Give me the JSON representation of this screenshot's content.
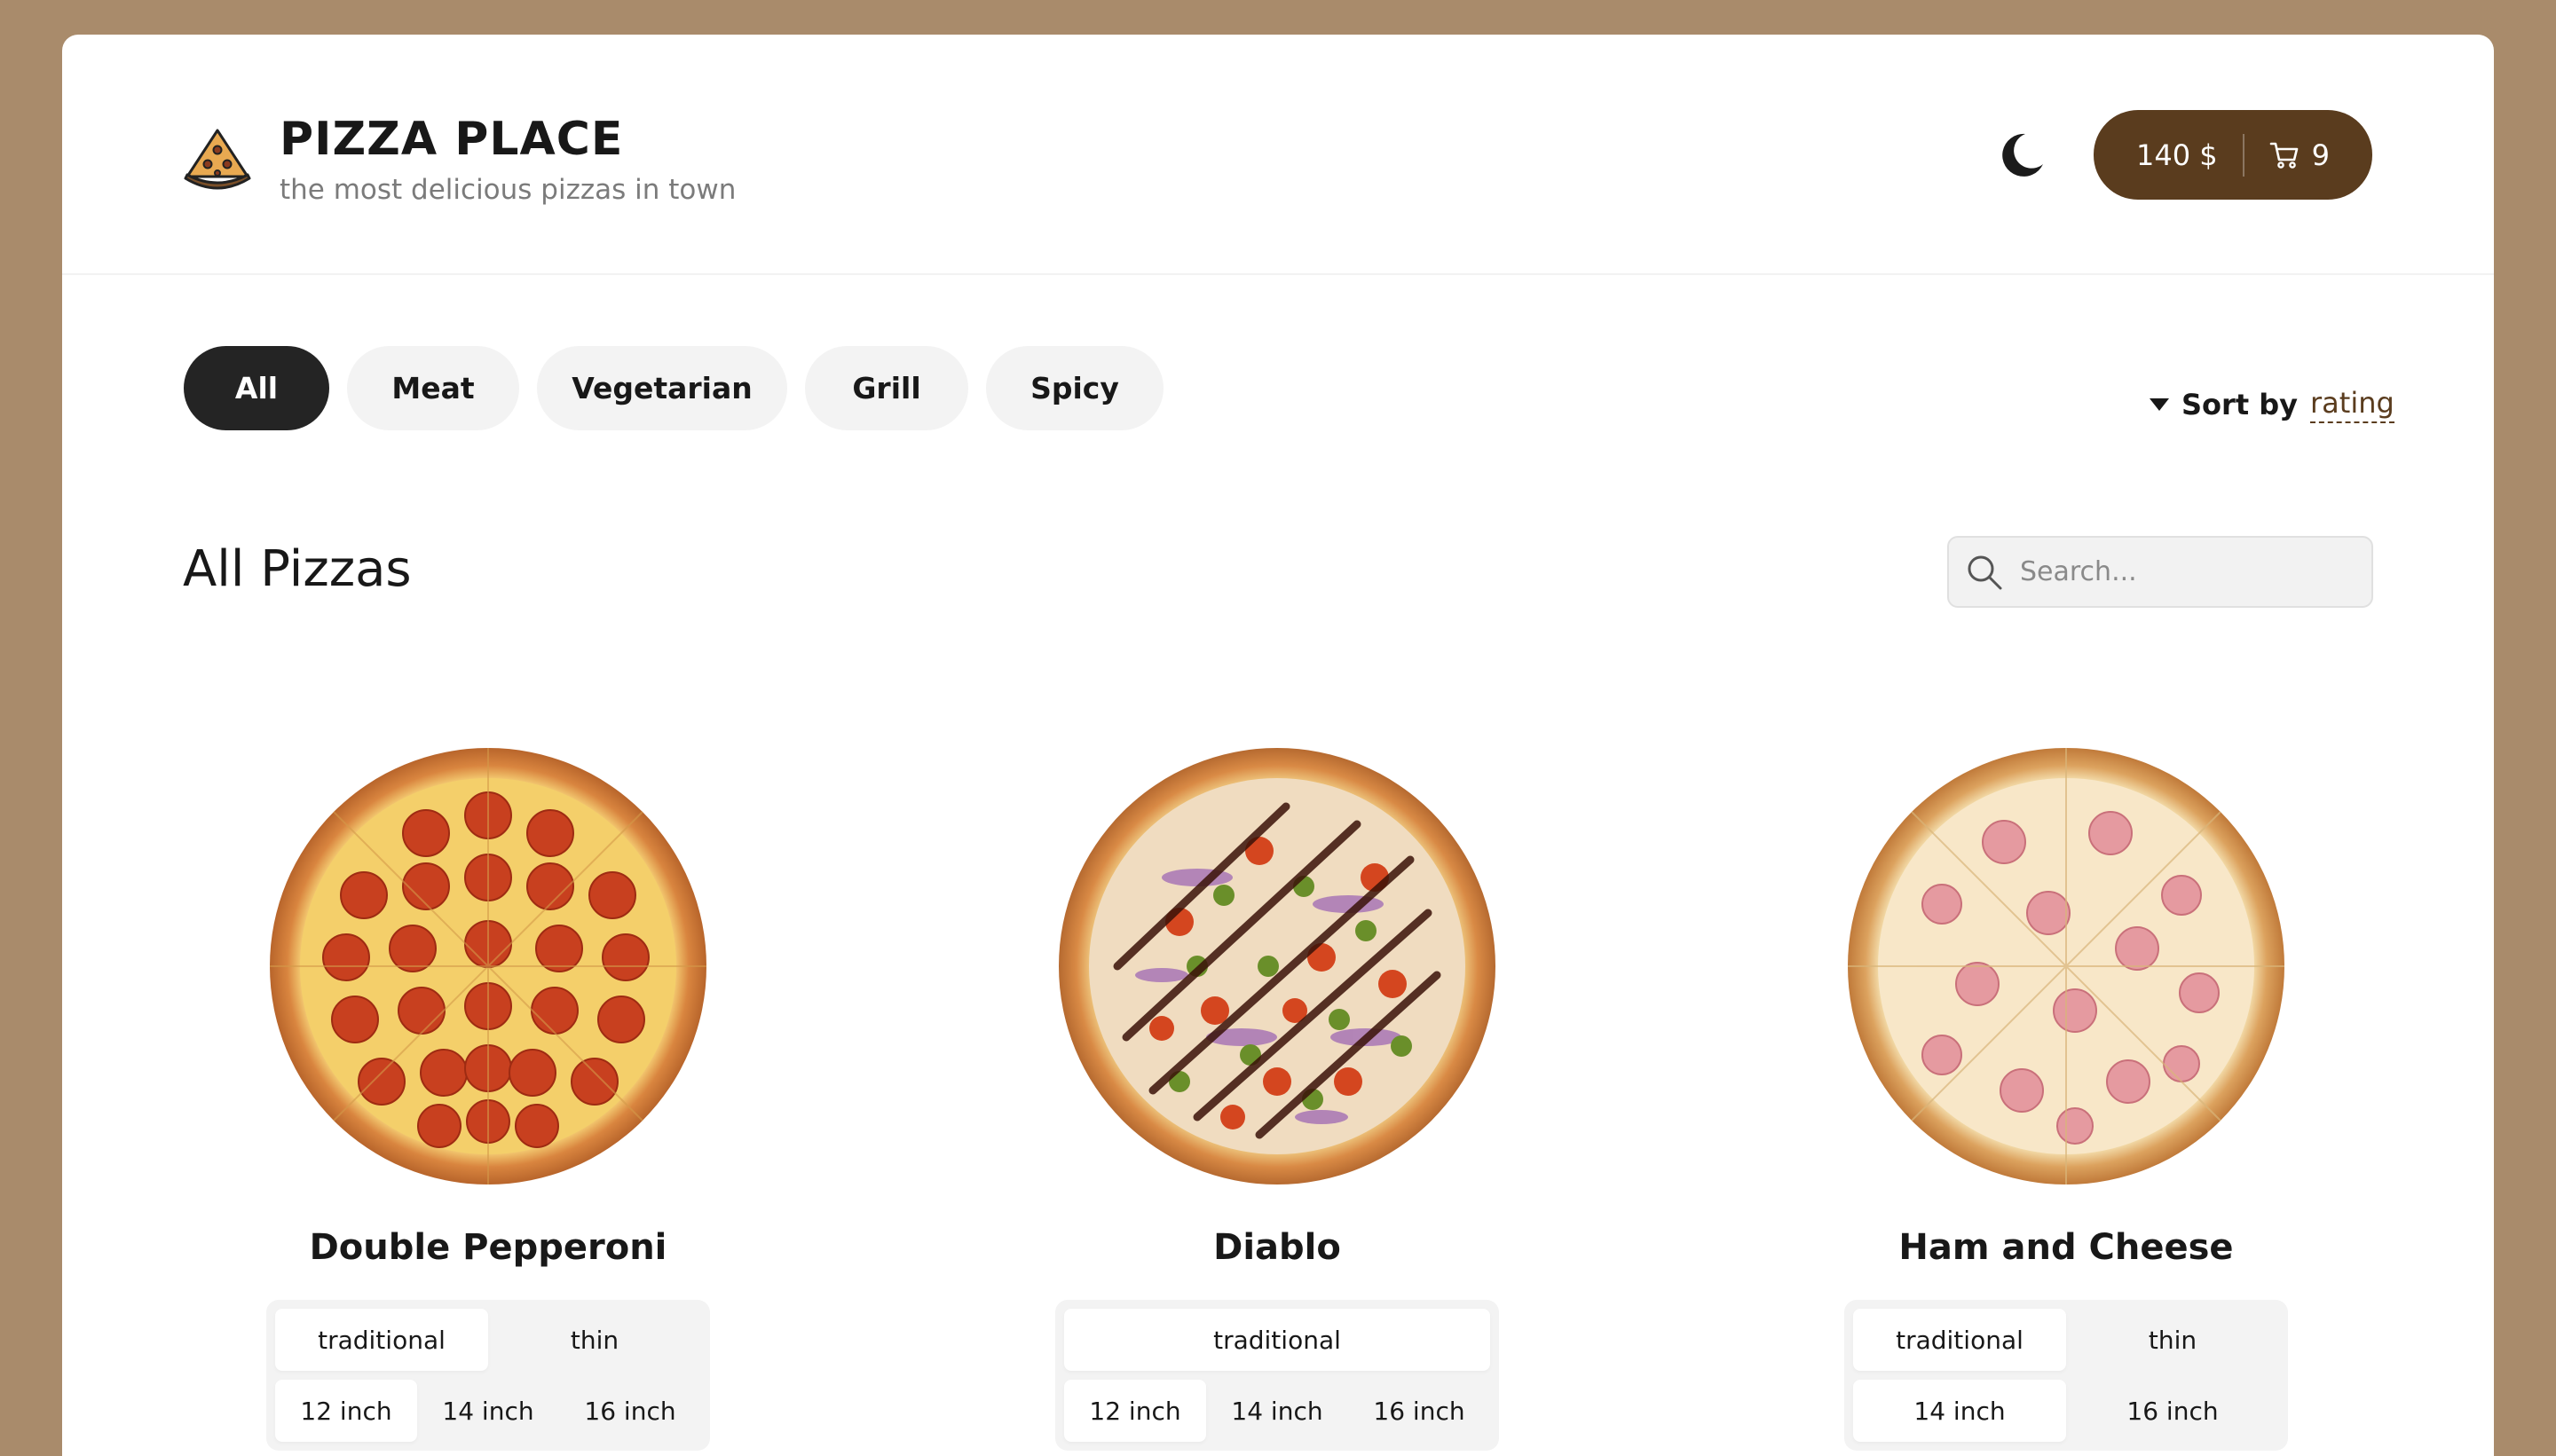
{
  "header": {
    "title": "PIZZA PLACE",
    "subtitle": "the most delicious pizzas in town",
    "logo_icon": "pizza-slice-icon",
    "theme_icon": "moon-icon",
    "cart": {
      "price": "140 $",
      "count": "9",
      "icon": "cart-icon"
    }
  },
  "categories": [
    {
      "label": "All",
      "active": true
    },
    {
      "label": "Meat",
      "active": false
    },
    {
      "label": "Vegetarian",
      "active": false
    },
    {
      "label": "Grill",
      "active": false
    },
    {
      "label": "Spicy",
      "active": false
    }
  ],
  "sort": {
    "label": "Sort by",
    "value": "rating"
  },
  "section": {
    "title": "All Pizzas",
    "search_placeholder": "Search..."
  },
  "pizzas": [
    {
      "name": "Double Pepperoni",
      "doughs": [
        "traditional",
        "thin"
      ],
      "active_dough": "traditional",
      "sizes": [
        "12 inch",
        "14 inch",
        "16 inch"
      ],
      "active_size": "12 inch"
    },
    {
      "name": "Diablo",
      "doughs": [
        "traditional"
      ],
      "active_dough": "traditional",
      "sizes": [
        "12 inch",
        "14 inch",
        "16 inch"
      ],
      "active_size": "12 inch"
    },
    {
      "name": "Ham and Cheese",
      "doughs": [
        "traditional",
        "thin"
      ],
      "active_dough": "traditional",
      "sizes": [
        "14 inch",
        "16 inch"
      ],
      "active_size": "14 inch"
    }
  ],
  "colors": {
    "background": "#a98b6b",
    "accent": "#5a3c1e",
    "active_category": "#242424"
  }
}
